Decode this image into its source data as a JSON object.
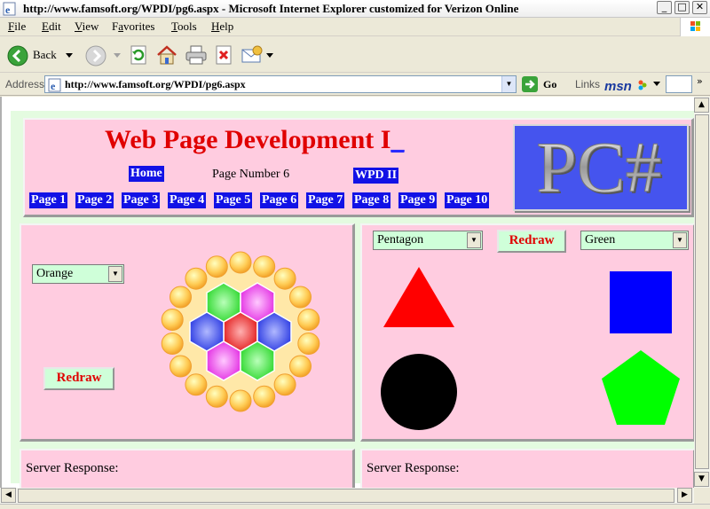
{
  "window": {
    "title": "http://www.famsoft.org/WPDI/pg6.aspx - Microsoft Internet Explorer customized for Verizon Online",
    "minimize_icon": "minimize-icon",
    "maximize_icon": "maximize-icon",
    "close_icon": "close-icon",
    "close_glyph": "✕",
    "minimize_glyph": "_",
    "maximize_glyph": "□"
  },
  "menu": {
    "items": [
      "File",
      "Edit",
      "View",
      "Favorites",
      "Tools",
      "Help"
    ],
    "underline": [
      "F",
      "E",
      "V",
      "a",
      "T",
      "H"
    ]
  },
  "toolbar": {
    "back_label": "Back",
    "icons": [
      "back-icon",
      "forward-icon",
      "refresh-icon",
      "home-icon",
      "print-icon",
      "stop-icon",
      "mail-icon"
    ]
  },
  "address": {
    "label": "Address",
    "url": "http://www.famsoft.org/WPDI/pg6.aspx",
    "go_label": "Go",
    "links_label": "Links"
  },
  "page": {
    "title": "Web Page Development I",
    "cursor": "_",
    "home_label": "Home",
    "page_number_text": "Page Number 6",
    "wpd2_label": "WPD II",
    "nav_pages": [
      "Page 1",
      "Page 2",
      "Page 3",
      "Page 4",
      "Page 5",
      "Page 6",
      "Page 7",
      "Page 8",
      "Page 9",
      "Page 10"
    ],
    "logo_text": "PC#"
  },
  "left_panel": {
    "color_select": "Orange",
    "redraw_label": "Redraw"
  },
  "right_panel": {
    "shape_select": "Pentagon",
    "redraw_label": "Redraw",
    "color_select": "Green"
  },
  "server": {
    "left_label": "Server Response:",
    "right_label": "Server Response:"
  },
  "colors": {
    "panel_bg": "#ffcce0",
    "nav_bg": "#1212e6",
    "title_red": "#e00000",
    "logo_bg": "#4554ee",
    "button_bg": "#cfffd9"
  }
}
